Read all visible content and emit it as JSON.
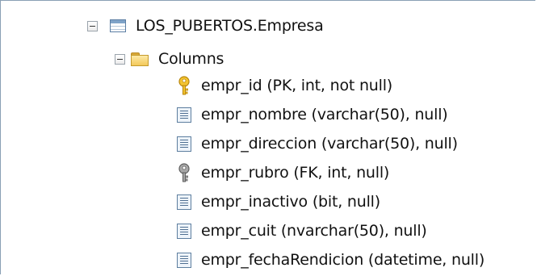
{
  "tree": {
    "table": {
      "label": "LOS_PUBERTOS.Empresa",
      "icon": "table-icon"
    },
    "folder": {
      "label": "Columns",
      "icon": "folder-icon"
    },
    "columns": [
      {
        "label": "empr_id (PK, int, not null)",
        "icon": "primary-key-icon"
      },
      {
        "label": "empr_nombre (varchar(50), null)",
        "icon": "column-icon"
      },
      {
        "label": "empr_direccion (varchar(50), null)",
        "icon": "column-icon"
      },
      {
        "label": "empr_rubro (FK, int, null)",
        "icon": "foreign-key-icon"
      },
      {
        "label": "empr_inactivo (bit, null)",
        "icon": "column-icon"
      },
      {
        "label": "empr_cuit (nvarchar(50), null)",
        "icon": "column-icon"
      },
      {
        "label": "empr_fechaRendicion (datetime, null)",
        "icon": "column-icon"
      }
    ]
  },
  "colors": {
    "primary_key": "#e8b21c",
    "foreign_key": "#8c8c8c",
    "border": "#8aa0b4"
  }
}
